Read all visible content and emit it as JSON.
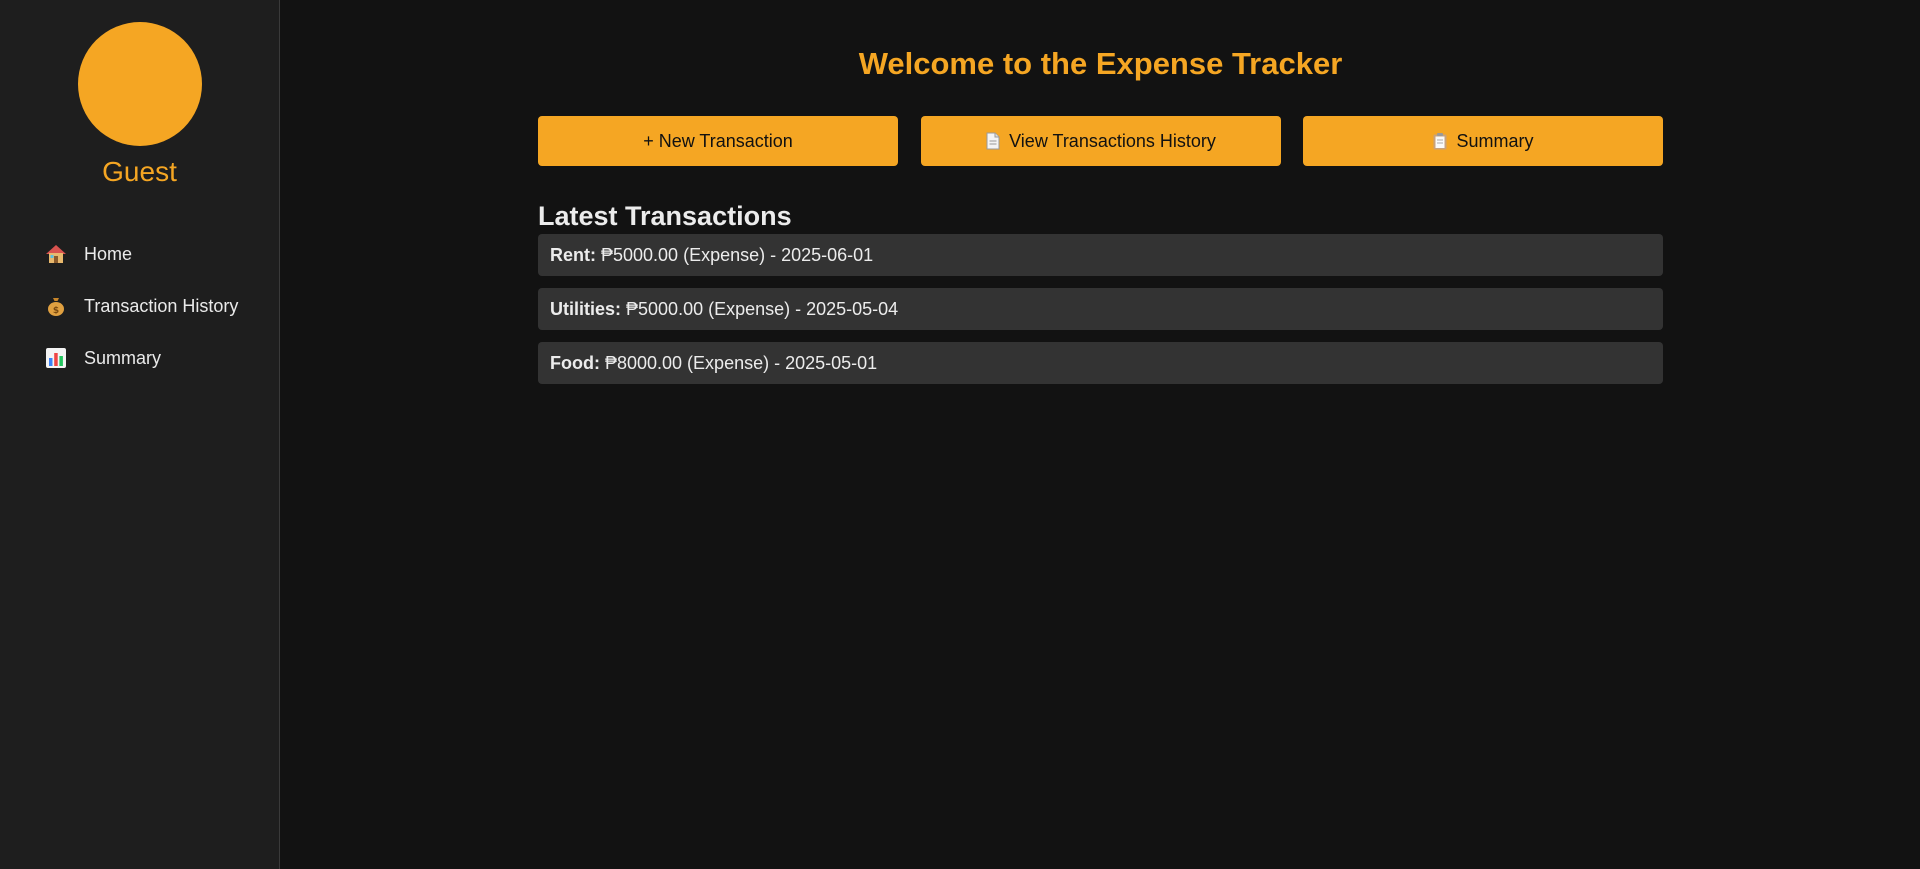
{
  "sidebar": {
    "username": "Guest",
    "avatar_color": "#f5a623",
    "items": [
      {
        "label": "Home",
        "icon": "house-icon"
      },
      {
        "label": "Transaction History",
        "icon": "money-bag-icon"
      },
      {
        "label": "Summary",
        "icon": "bar-chart-icon"
      }
    ]
  },
  "main": {
    "title": "Welcome to the Expense Tracker",
    "actions": [
      {
        "label": "+ New Transaction"
      },
      {
        "label": "View Transactions History",
        "icon": "document-icon"
      },
      {
        "label": "Summary",
        "icon": "clipboard-icon"
      }
    ],
    "latest_title": "Latest Transactions",
    "transactions": [
      {
        "category": "Rent:",
        "details": "₱5000.00 (Expense) - 2025-06-01"
      },
      {
        "category": "Utilities:",
        "details": "₱5000.00 (Expense) - 2025-05-04"
      },
      {
        "category": "Food:",
        "details": "₱8000.00 (Expense) - 2025-05-01"
      }
    ]
  },
  "colors": {
    "accent": "#f5a623",
    "background": "#121212",
    "sidebar": "#1e1e1e",
    "card": "#333333"
  }
}
